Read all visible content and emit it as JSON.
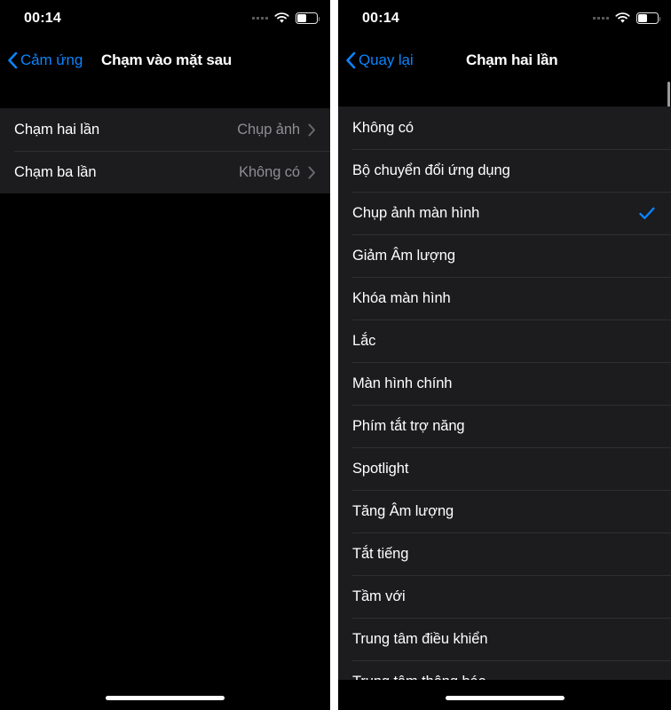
{
  "left_screen": {
    "status_bar": {
      "time": "00:14",
      "signal_icon": "signal-dots-icon",
      "wifi_icon": "wifi-icon",
      "battery_icon": "battery-icon",
      "battery_level_percent": 48
    },
    "nav": {
      "back_icon": "chevron-left-icon",
      "back_label": "Cảm ứng",
      "title": "Chạm vào mặt sau"
    },
    "rows": [
      {
        "label": "Chạm hai lần",
        "value": "Chụp ảnh",
        "disclosure_icon": "chevron-right-icon"
      },
      {
        "label": "Chạm ba lần",
        "value": "Không có",
        "disclosure_icon": "chevron-right-icon"
      }
    ],
    "home_indicator": "home-indicator"
  },
  "right_screen": {
    "status_bar": {
      "time": "00:14",
      "signal_icon": "signal-dots-icon",
      "wifi_icon": "wifi-icon",
      "battery_icon": "battery-icon",
      "battery_level_percent": 48
    },
    "nav": {
      "back_icon": "chevron-left-icon",
      "back_label": "Quay lại",
      "title": "Chạm hai lần"
    },
    "options": [
      {
        "label": "Không có",
        "selected": false
      },
      {
        "label": "Bộ chuyển đổi ứng dụng",
        "selected": false
      },
      {
        "label": "Chụp ảnh màn hình",
        "selected": true
      },
      {
        "label": "Giảm Âm lượng",
        "selected": false
      },
      {
        "label": "Khóa màn hình",
        "selected": false
      },
      {
        "label": "Lắc",
        "selected": false
      },
      {
        "label": "Màn hình chính",
        "selected": false
      },
      {
        "label": "Phím tắt trợ năng",
        "selected": false
      },
      {
        "label": "Spotlight",
        "selected": false
      },
      {
        "label": "Tăng Âm lượng",
        "selected": false
      },
      {
        "label": "Tắt tiếng",
        "selected": false
      },
      {
        "label": "Tầm với",
        "selected": false
      },
      {
        "label": "Trung tâm điều khiển",
        "selected": false
      },
      {
        "label": "Trung tâm thông báo",
        "selected": false
      }
    ],
    "checkmark_icon": "checkmark-icon",
    "scrollbar": "vertical-scrollbar",
    "home_indicator": "home-indicator"
  },
  "colors": {
    "accent_blue": "#0a84ff",
    "background_black": "#000000",
    "row_background": "#1c1c1e",
    "separator": "#2f2f31",
    "secondary_text": "#8e8e93",
    "primary_text": "#ffffff"
  }
}
